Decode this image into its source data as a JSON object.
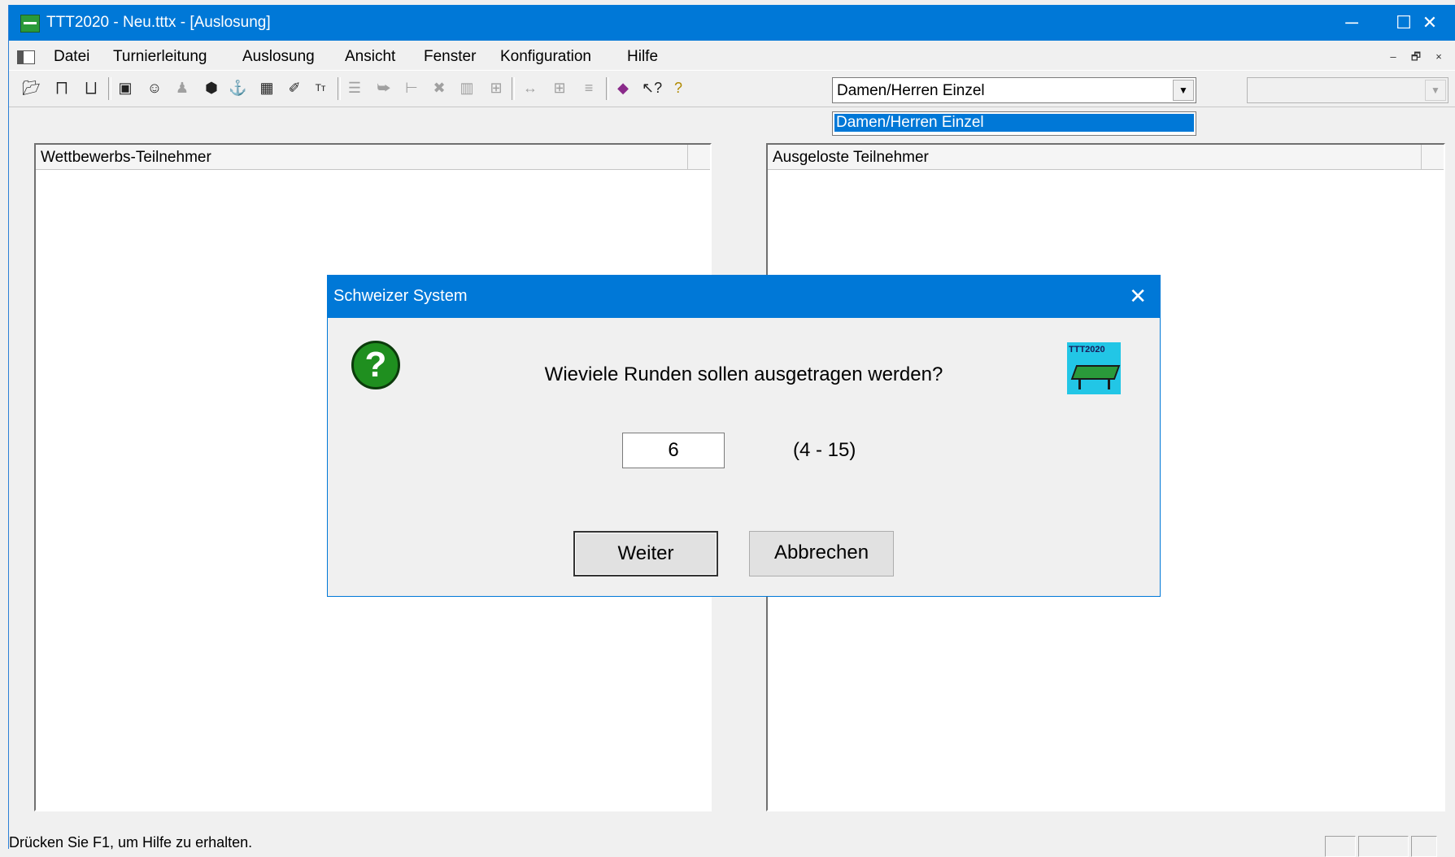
{
  "window": {
    "title": "TTT2020 - Neu.tttx - [Auslosung]",
    "minimize_glyph": "─",
    "maximize_glyph": "☐",
    "close_glyph": "✕"
  },
  "menu": {
    "items": [
      "Datei",
      "Turnierleitung",
      "Auslosung",
      "Ansicht",
      "Fenster",
      "Konfiguration",
      "Hilfe"
    ],
    "mdi_minimize": "–",
    "mdi_restore": "🗗",
    "mdi_close": "×"
  },
  "toolbar": {
    "competition_combo_value": "Damen/Herren Einzel",
    "dropdown_options": [
      "Damen/Herren Einzel"
    ],
    "dropdown_selected": "Damen/Herren Einzel",
    "help_icon_glyph": "?"
  },
  "panels": {
    "left_header": "Wettbewerbs-Teilnehmer",
    "right_header": "Ausgeloste Teilnehmer"
  },
  "dialog": {
    "title": "Schweizer System",
    "question": "Wieviele Runden sollen ausgetragen werden?",
    "rounds_value": "6",
    "range_text": "(4 - 15)",
    "ok_label": "Weiter",
    "cancel_label": "Abbrechen",
    "logo_text": "TTT2020",
    "question_icon_glyph": "?"
  },
  "status": {
    "text": "Drücken Sie F1, um Hilfe zu erhalten."
  },
  "colors": {
    "titlebar": "#0078d7",
    "selection": "#0078d7",
    "question_icon": "#1f8f1f",
    "logo_bg": "#22c6e6"
  }
}
